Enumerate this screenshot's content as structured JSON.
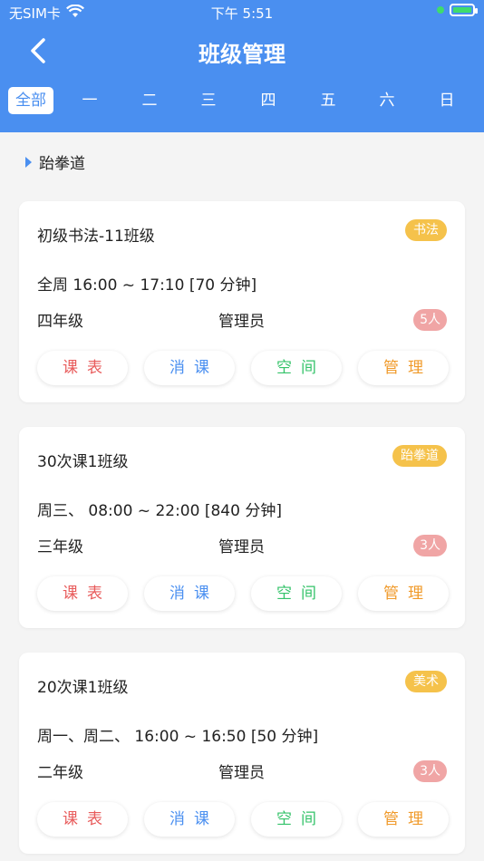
{
  "status_bar": {
    "carrier": "无SIM卡",
    "time": "下午 5:51"
  },
  "header": {
    "title": "班级管理"
  },
  "tabs": [
    "全部",
    "一",
    "二",
    "三",
    "四",
    "五",
    "六",
    "日"
  ],
  "section": {
    "label": "跆拳道"
  },
  "buttons": {
    "schedule": "课表",
    "consume": "消课",
    "space": "空间",
    "manage": "管理"
  },
  "classes": [
    {
      "name": "初级书法-11班级",
      "tag": "书法",
      "time": "全周 16:00 ~ 17:10 [70 分钟]",
      "grade": "四年级",
      "manager": "管理员",
      "count": "5人"
    },
    {
      "name": "30次课1班级",
      "tag": "跆拳道",
      "time": "周三、 08:00 ~ 22:00 [840 分钟]",
      "grade": "三年级",
      "manager": "管理员",
      "count": "3人"
    },
    {
      "name": "20次课1班级",
      "tag": "美术",
      "time": "周一、周二、 16:00 ~ 16:50 [50 分钟]",
      "grade": "二年级",
      "manager": "管理员",
      "count": "3人"
    }
  ],
  "colors": {
    "primary": "#4a8ff0",
    "tag": "#f5c24b",
    "count": "#f0a5a5"
  }
}
